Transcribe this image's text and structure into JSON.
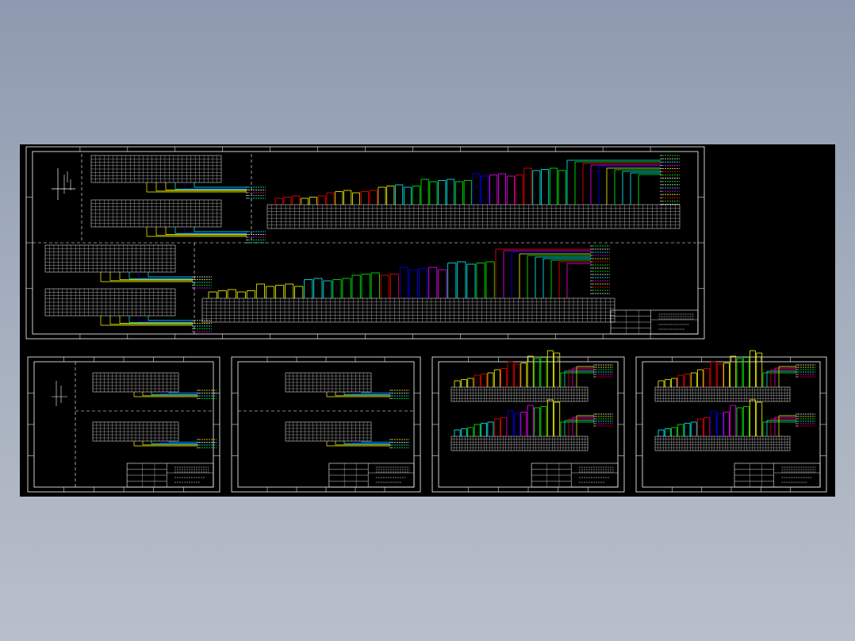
{
  "drawing": {
    "background": "#000000",
    "frame_color": "#ffffff",
    "dash_color": "#ffffff",
    "text_color": "#ffffff",
    "cable_colors": [
      "#ffff00",
      "#ff0000",
      "#00ffff",
      "#00ff00",
      "#0000ff",
      "#ff00ff",
      "#ffffff"
    ]
  },
  "sheets": [
    {
      "id": "main-sheet"
    },
    {
      "id": "sheet-2"
    },
    {
      "id": "sheet-3"
    },
    {
      "id": "sheet-4"
    },
    {
      "id": "sheet-5"
    }
  ]
}
